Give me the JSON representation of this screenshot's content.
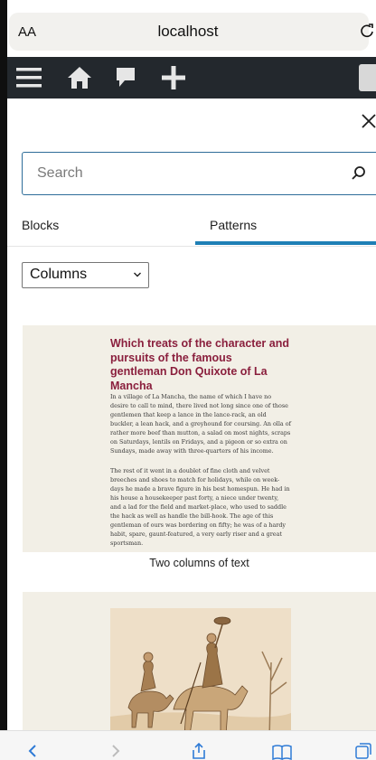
{
  "browser": {
    "text_size_label": "AA",
    "host": "localhost"
  },
  "inserter": {
    "search_placeholder": "Search",
    "tabs": [
      {
        "label": "Blocks",
        "active": false
      },
      {
        "label": "Patterns",
        "active": true
      }
    ],
    "category_selected": "Columns",
    "patterns": [
      {
        "title": "Which treats of the character and pursuits of the famous gentleman Don Quixote of La Mancha",
        "paragraphs": [
          "In a village of La Mancha, the name of which I have no desire to call to mind, there lived not long since one of those gentlemen that keep a lance in the lance-rack, an old buckler, a lean hack, and a greyhound for coursing. An olla of rather more beef than mutton, a salad on most nights, scraps on Saturdays, lentils on Fridays, and a pigeon or so extra on Sundays, made away with three-quarters of his income.",
          "The rest of it went in a doublet of fine cloth and velvet breeches and shoes to match for holidays, while on week-days he made a brave figure in his best homespun. He had in his house a housekeeper past forty, a niece under twenty, and a lad for the field and market-place, who used to saddle the hack as well as handle the bill-hook. The age of this gentleman of ours was bordering on fifty; he was of a hardy habit, spare, gaunt-featured, a very early riser and a great sportsman."
        ],
        "caption": "Two columns of text"
      },
      {
        "image": "don-quixote-illustration"
      }
    ]
  },
  "colors": {
    "accent": "#1e7fb5",
    "title": "#8a1f3d",
    "card_bg": "#f2efe6",
    "admin_bar": "#23282d"
  }
}
